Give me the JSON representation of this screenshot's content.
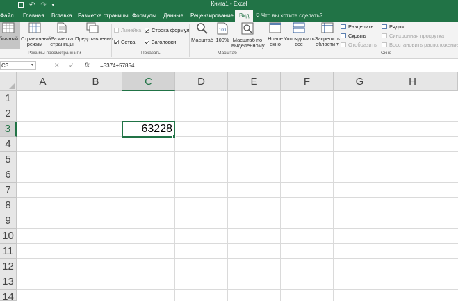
{
  "window": {
    "title": "Книга1 - Excel"
  },
  "qat": {
    "save": "",
    "undo": "↶",
    "redo": "↷"
  },
  "tabs": [
    "Файл",
    "Главная",
    "Вставка",
    "Разметка страницы",
    "Формулы",
    "Данные",
    "Рецензирование",
    "Вид"
  ],
  "active_tab": "Вид",
  "tell_me": "Что вы хотите сделать?",
  "ribbon": {
    "views": {
      "group_label": "Режимы просмотра книги",
      "normal": "Обычный",
      "page_break_1": "Страничный",
      "page_break_2": "режим",
      "page_layout_1": "Разметка",
      "page_layout_2": "страницы",
      "custom_views": "Представления"
    },
    "show": {
      "group_label": "Показать",
      "ruler": "Линейка",
      "formula_bar": "Строка формул",
      "gridlines": "Сетка",
      "headings": "Заголовки"
    },
    "zoom": {
      "group_label": "Масштаб",
      "zoom": "Масштаб",
      "hundred": "100%",
      "zoom_sel_1": "Масштаб по",
      "zoom_sel_2": "выделенному"
    },
    "window": {
      "group_label": "Окно",
      "new_1": "Новое",
      "new_2": "окно",
      "arrange_1": "Упорядочить",
      "arrange_2": "все",
      "freeze_1": "Закрепить",
      "freeze_2": "области",
      "split": "Разделить",
      "hide": "Скрыть",
      "unhide": "Отобразить",
      "side_by_side": "Рядом",
      "sync_scroll": "Синхронная прокрутка",
      "reset_pos": "Восстановить расположение окна"
    }
  },
  "formula_bar": {
    "name_box": "C3",
    "fx": "fx",
    "formula": "=5374+57854"
  },
  "columns": [
    "A",
    "B",
    "C",
    "D",
    "E",
    "F",
    "G",
    "H"
  ],
  "rows": [
    "1",
    "2",
    "3",
    "4",
    "5",
    "6",
    "7",
    "8",
    "9",
    "10",
    "11",
    "12",
    "13",
    "14"
  ],
  "selected": {
    "column": "C",
    "row": "3"
  },
  "cells": {
    "C3": "63228"
  },
  "colors": {
    "accent": "#217346",
    "header_bg": "#e6e6e6",
    "gridline": "#dadada"
  }
}
